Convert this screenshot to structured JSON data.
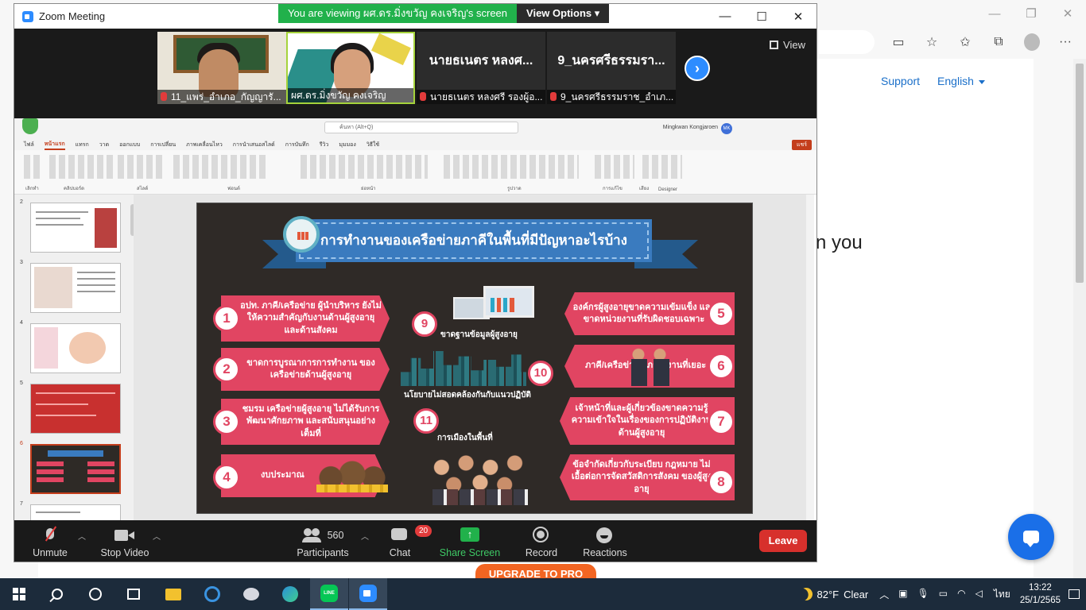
{
  "browser": {
    "nav": {
      "support": "Support",
      "language": "English"
    },
    "hero_fragment": "n you",
    "upgrade_label": "UPGRADE TO PRO",
    "icons": [
      "reader-icon",
      "favorite-add-icon",
      "favorites-icon",
      "collections-icon",
      "profile-icon",
      "more-icon"
    ]
  },
  "zoom": {
    "title": "Zoom Meeting",
    "banner": {
      "message": "You are viewing ผศ.ดร.มิ่งขวัญ คงเจริญ's screen",
      "options": "View Options"
    },
    "view_label": "View",
    "participants": [
      {
        "name": "11_แพร่_อำเภอ_กัญญารั...",
        "muted": true,
        "type": "video"
      },
      {
        "name": "ผศ.ดร.มิ่งขวัญ คงเจริญ",
        "muted": false,
        "type": "video",
        "active": true
      },
      {
        "name": "นายธเนตร หลงศรี รองผู้อ...",
        "big_label": "นายธเนตร หลงศ...",
        "muted": true,
        "type": "name"
      },
      {
        "name": "9_นครศรีธรรมราช_อำเภ...",
        "big_label": "9_นครศรีธรรมรา...",
        "muted": true,
        "type": "name"
      }
    ],
    "controls": {
      "unmute": "Unmute",
      "stop_video": "Stop Video",
      "participants": "Participants",
      "participants_count": "560",
      "chat": "Chat",
      "chat_badge": "20",
      "share_screen": "Share Screen",
      "record": "Record",
      "reactions": "Reactions",
      "leave": "Leave"
    }
  },
  "ppt": {
    "search_placeholder": "ค้นหา (Alt+Q)",
    "user_name": "Mingkwan Kongjaroen",
    "user_initials": "MK",
    "share_label": "แชร์",
    "tabs": [
      "ไฟล์",
      "หน้าแรก",
      "แทรก",
      "วาด",
      "ออกแบบ",
      "การเปลี่ยน",
      "ภาพเคลื่อนไหว",
      "การนำเสนอสไลด์",
      "การบันทึก",
      "รีวิว",
      "มุมมอง",
      "วิธีใช้"
    ],
    "groups": [
      "เลิกทำ",
      "คลิปบอร์ด",
      "สไลด์",
      "ฟอนต์",
      "ย่อหน้า",
      "รูปวาด",
      "การแก้ไข",
      "เสียง",
      "Designer"
    ],
    "slide_numbers": [
      "2",
      "3",
      "4",
      "5",
      "6",
      "7"
    ],
    "selected_slide": "6"
  },
  "slide": {
    "title": "การทำงานของเครือข่ายภาคีในพื้นที่มีปัญหาอะไรบ้าง",
    "left_items": [
      {
        "num": "1",
        "text": "อปท. ภาคี/เครือข่าย ผู้นำบริหาร ยังไม่ให้ความสำคัญกับงานด้านผู้สูงอายุ และด้านสังคม"
      },
      {
        "num": "2",
        "text": "ขาดการบูรณาการการทำงาน ของเครือข่ายด้านผู้สูงอายุ"
      },
      {
        "num": "3",
        "text": "ชมรม เครือข่ายผู้สูงอายุ ไม่ได้รับการพัฒนาศักยภาพ และสนับสนุนอย่างเต็มที่"
      },
      {
        "num": "4",
        "text": "งบประมาณ"
      }
    ],
    "right_items": [
      {
        "num": "5",
        "text": "องค์กรผู้สูงอายุขาดความเข้มแข็ง และขาดหน่วยงานที่รับผิดชอบเฉพาะ"
      },
      {
        "num": "6",
        "text": "ภาคี/เครือข่าย มีภาระงานที่เยอะ"
      },
      {
        "num": "7",
        "text": "เจ้าหน้าที่และผู้เกี่ยวข้องขาดความรู้ ความเข้าใจในเรื่องของการปฏิบัติงาน ด้านผู้สูงอายุ"
      },
      {
        "num": "8",
        "text": "ข้อจำกัดเกี่ยวกับระเบียบ กฎหมาย ไม่เอื้อต่อการจัดสวัสดิการสังคม ของผู้สูงอายุ"
      }
    ],
    "mid_items": [
      {
        "num": "9",
        "text": "ขาดฐานข้อมูลผู้สูงอายุ"
      },
      {
        "num": "10",
        "text": "นโยบายไม่สอดคล้องกันกับแนวปฏิบัติ"
      },
      {
        "num": "11",
        "text": "การเมืองในพื้นที่"
      }
    ]
  },
  "taskbar": {
    "weather": {
      "temp": "82°F",
      "condition": "Clear"
    },
    "language": "ไทย",
    "time": "13:22",
    "date": "25/1/2565"
  },
  "colors": {
    "zoom_blue": "#2d8cff",
    "banner_green": "#21b14b",
    "leave_red": "#d7302c",
    "slide_pink": "#e14562",
    "slide_bg": "#2f2a27",
    "ribbon_blue": "#3a7bbf"
  }
}
